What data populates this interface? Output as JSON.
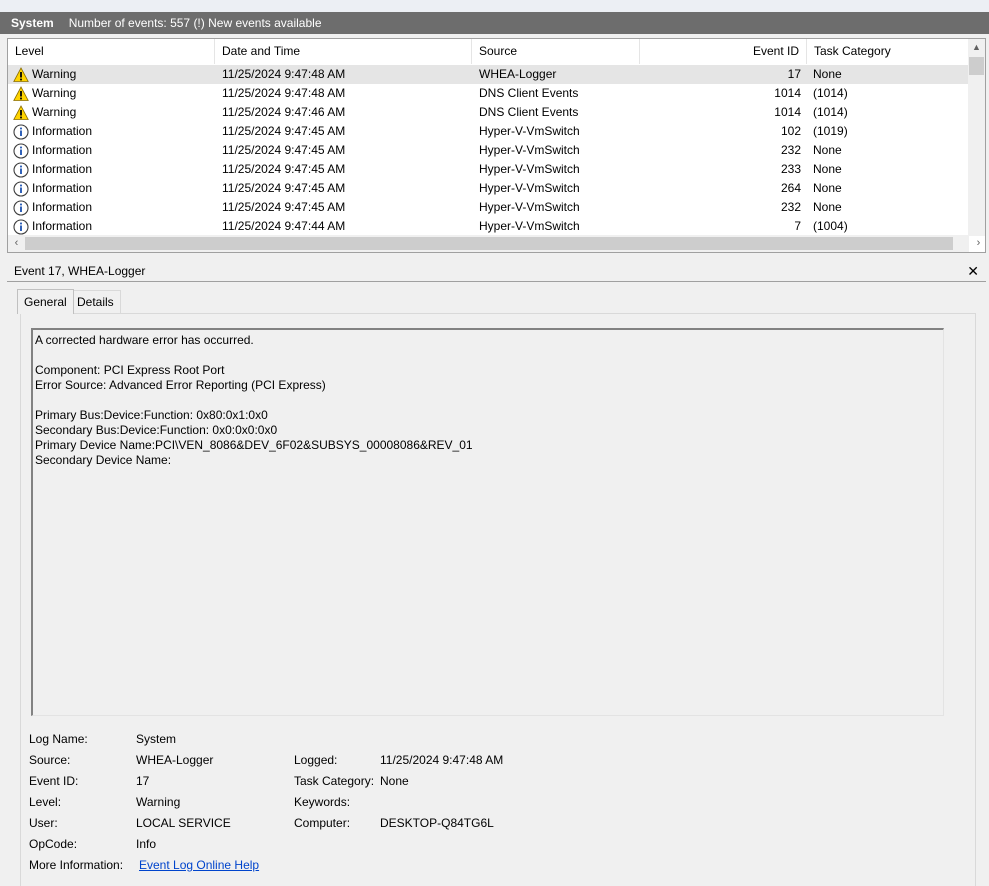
{
  "header": {
    "log_name": "System",
    "status": "Number of events: 557 (!) New events available"
  },
  "list": {
    "columns": [
      "Level",
      "Date and Time",
      "Source",
      "Event ID",
      "Task Category"
    ],
    "rows": [
      {
        "level": "Warning",
        "icon": "warning-icon",
        "date": "11/25/2024 9:47:48 AM",
        "source": "WHEA-Logger",
        "event_id": "17",
        "task": "None"
      },
      {
        "level": "Warning",
        "icon": "warning-icon",
        "date": "11/25/2024 9:47:48 AM",
        "source": "DNS Client Events",
        "event_id": "1014",
        "task": "(1014)"
      },
      {
        "level": "Warning",
        "icon": "warning-icon",
        "date": "11/25/2024 9:47:46 AM",
        "source": "DNS Client Events",
        "event_id": "1014",
        "task": "(1014)"
      },
      {
        "level": "Information",
        "icon": "info-icon",
        "date": "11/25/2024 9:47:45 AM",
        "source": "Hyper-V-VmSwitch",
        "event_id": "102",
        "task": "(1019)"
      },
      {
        "level": "Information",
        "icon": "info-icon",
        "date": "11/25/2024 9:47:45 AM",
        "source": "Hyper-V-VmSwitch",
        "event_id": "232",
        "task": "None"
      },
      {
        "level": "Information",
        "icon": "info-icon",
        "date": "11/25/2024 9:47:45 AM",
        "source": "Hyper-V-VmSwitch",
        "event_id": "233",
        "task": "None"
      },
      {
        "level": "Information",
        "icon": "info-icon",
        "date": "11/25/2024 9:47:45 AM",
        "source": "Hyper-V-VmSwitch",
        "event_id": "264",
        "task": "None"
      },
      {
        "level": "Information",
        "icon": "info-icon",
        "date": "11/25/2024 9:47:45 AM",
        "source": "Hyper-V-VmSwitch",
        "event_id": "232",
        "task": "None"
      },
      {
        "level": "Information",
        "icon": "info-icon",
        "date": "11/25/2024 9:47:44 AM",
        "source": "Hyper-V-VmSwitch",
        "event_id": "7",
        "task": "(1004)"
      }
    ]
  },
  "details": {
    "title": "Event 17, WHEA-Logger",
    "close_glyph": "✕",
    "tabs": [
      "General",
      "Details"
    ],
    "description": [
      "A corrected hardware error has occurred.",
      "",
      "Component: PCI Express Root Port",
      "Error Source: Advanced Error Reporting (PCI Express)",
      "",
      "Primary Bus:Device:Function: 0x80:0x1:0x0",
      "Secondary Bus:Device:Function: 0x0:0x0:0x0",
      "Primary Device Name:PCI\\VEN_8086&DEV_6F02&SUBSYS_00008086&REV_01",
      "Secondary Device Name:"
    ],
    "props": {
      "log_name_label": "Log Name:",
      "log_name": "System",
      "source_label": "Source:",
      "source": "WHEA-Logger",
      "event_id_label": "Event ID:",
      "event_id": "17",
      "level_label": "Level:",
      "level": "Warning",
      "user_label": "User:",
      "user": "LOCAL SERVICE",
      "opcode_label": "OpCode:",
      "opcode": "Info",
      "more_info_label": "More Information:",
      "more_info_link": "Event Log Online Help",
      "logged_label": "Logged:",
      "logged": "11/25/2024 9:47:48 AM",
      "task_category_label": "Task Category:",
      "task_category": "None",
      "keywords_label": "Keywords:",
      "keywords": "",
      "computer_label": "Computer:",
      "computer": "DESKTOP-Q84TG6L"
    }
  }
}
